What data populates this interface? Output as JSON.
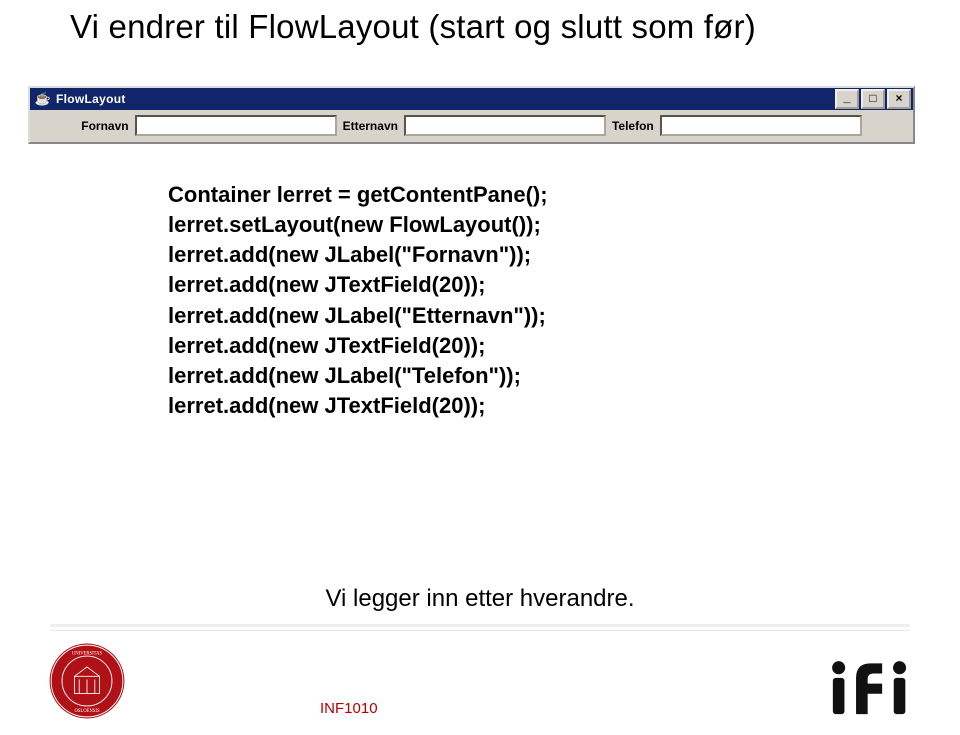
{
  "title": "Vi endrer til FlowLayout (start og slutt som før)",
  "window": {
    "title": "FlowLayout",
    "min_glyph": "_",
    "max_glyph": "□",
    "close_glyph": "×",
    "labels": {
      "fornavn": "Fornavn",
      "etternavn": "Etternavn",
      "telefon": "Telefon"
    }
  },
  "code": {
    "l1": "Container lerret = getContentPane();",
    "l2": "lerret.setLayout(new FlowLayout());",
    "l3": "lerret.add(new JLabel(\"Fornavn\"));",
    "l4": "lerret.add(new JTextField(20));",
    "l5": "lerret.add(new JLabel(\"Etternavn\"));",
    "l6": "lerret.add(new JTextField(20));",
    "l7": "lerret.add(new JLabel(\"Telefon\"));",
    "l8": "lerret.add(new JTextField(20));"
  },
  "note": "Vi legger inn etter hverandre.",
  "footer": "INF1010",
  "icons": {
    "java": "☕"
  }
}
